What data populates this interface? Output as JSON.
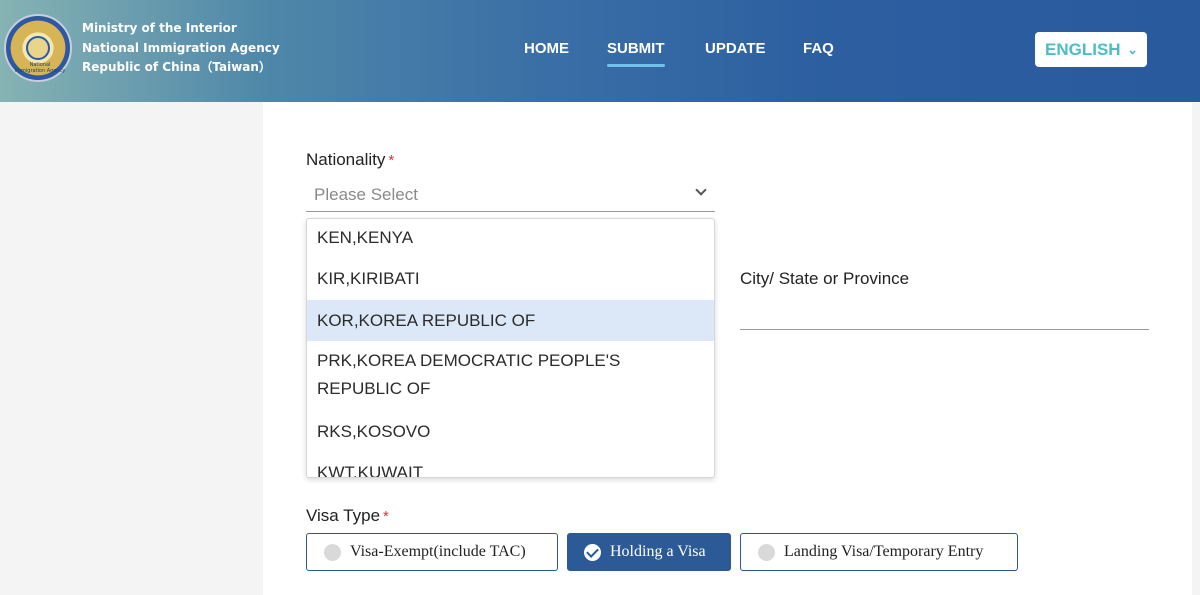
{
  "header": {
    "agency_lines": [
      "Ministry of the Interior",
      "National Immigration Agency",
      "Republic of China（Taiwan）"
    ],
    "logo_text": "National Immigration Agency",
    "nav": [
      "HOME",
      "SUBMIT",
      "UPDATE",
      "FAQ"
    ],
    "active_nav": "SUBMIT",
    "language": "ENGLISH",
    "lang_chevron": "⌄"
  },
  "form": {
    "nationality": {
      "label": "Nationality",
      "required_mark": "*",
      "placeholder": "Please Select",
      "options": [
        "KEN,KENYA",
        "KIR,KIRIBATI",
        "KOR,KOREA REPUBLIC OF",
        "PRK,KOREA DEMOCRATIC PEOPLE'S",
        "REPUBLIC OF",
        "RKS,KOSOVO",
        "KWT,KUWAIT"
      ],
      "highlighted_option": "KOR,KOREA REPUBLIC OF"
    },
    "city": {
      "label": "City/ State or Province",
      "value": ""
    },
    "visa_type": {
      "label": "Visa Type",
      "required_mark": "*",
      "options": [
        "Visa-Exempt(include TAC)",
        "Holding a Visa",
        "Landing Visa/Temporary Entry"
      ],
      "selected": "Holding a Visa"
    }
  },
  "colors": {
    "brand_blue": "#2c5a96",
    "accent_teal": "#4cbcc8",
    "highlight": "#dce8f8",
    "required": "#dd3333"
  }
}
